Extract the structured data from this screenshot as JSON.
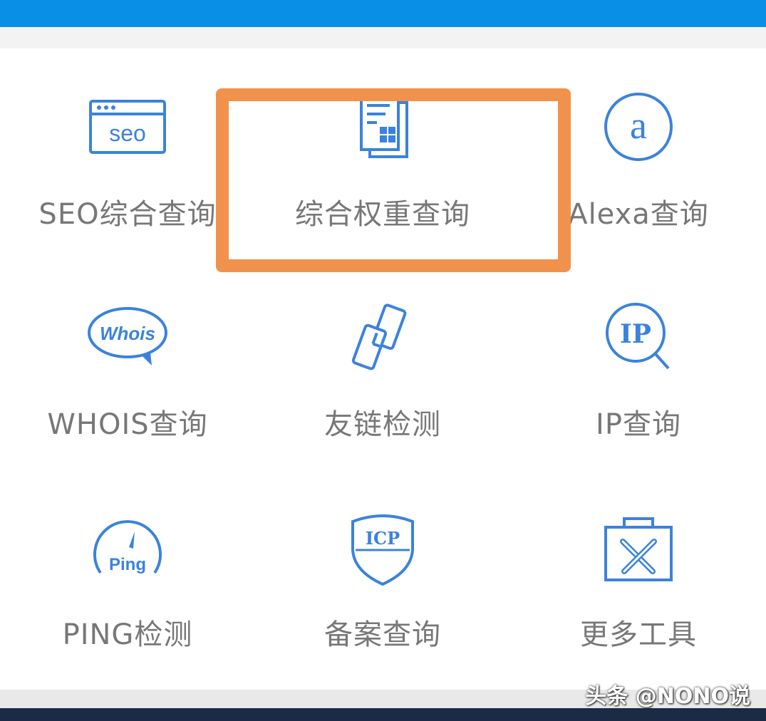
{
  "tools": [
    {
      "label": "SEO综合查询",
      "icon": "seo-icon"
    },
    {
      "label": "综合权重查询",
      "icon": "weight-report-icon"
    },
    {
      "label": "Alexa查询",
      "icon": "alexa-icon"
    },
    {
      "label": "WHOIS查询",
      "icon": "whois-icon"
    },
    {
      "label": "友链检测",
      "icon": "link-icon"
    },
    {
      "label": "IP查询",
      "icon": "ip-icon"
    },
    {
      "label": "PING检测",
      "icon": "ping-icon"
    },
    {
      "label": "备案查询",
      "icon": "icp-icon"
    },
    {
      "label": "更多工具",
      "icon": "toolbox-icon"
    }
  ],
  "icon_text": {
    "seo": "seo",
    "alexa": "a",
    "whois": "Whois",
    "ip": "IP",
    "ping": "Ping",
    "icp": "ICP"
  },
  "watermark": "头条 @NONO说",
  "colors": {
    "accent": "#3b82dc",
    "topbar": "#0a8fe6",
    "highlight": "#f0924c",
    "label": "#777777"
  }
}
